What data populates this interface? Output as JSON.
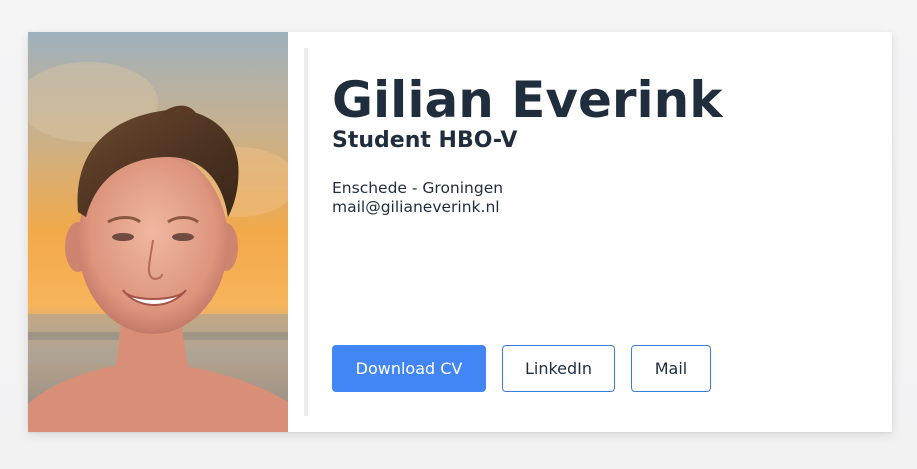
{
  "profile": {
    "name": "Gilian Everink",
    "role": "Student HBO-V",
    "location": "Enschede - Groningen",
    "email": "mail@gilianeverink.nl"
  },
  "buttons": {
    "download_cv": "Download CV",
    "linkedin": "LinkedIn",
    "mail": "Mail"
  },
  "colors": {
    "primary": "#4285f4",
    "outline_border": "#3d7bd9",
    "text": "#1f2d3d",
    "card_background": "#ffffff",
    "page_background": "#f4f4f5"
  }
}
